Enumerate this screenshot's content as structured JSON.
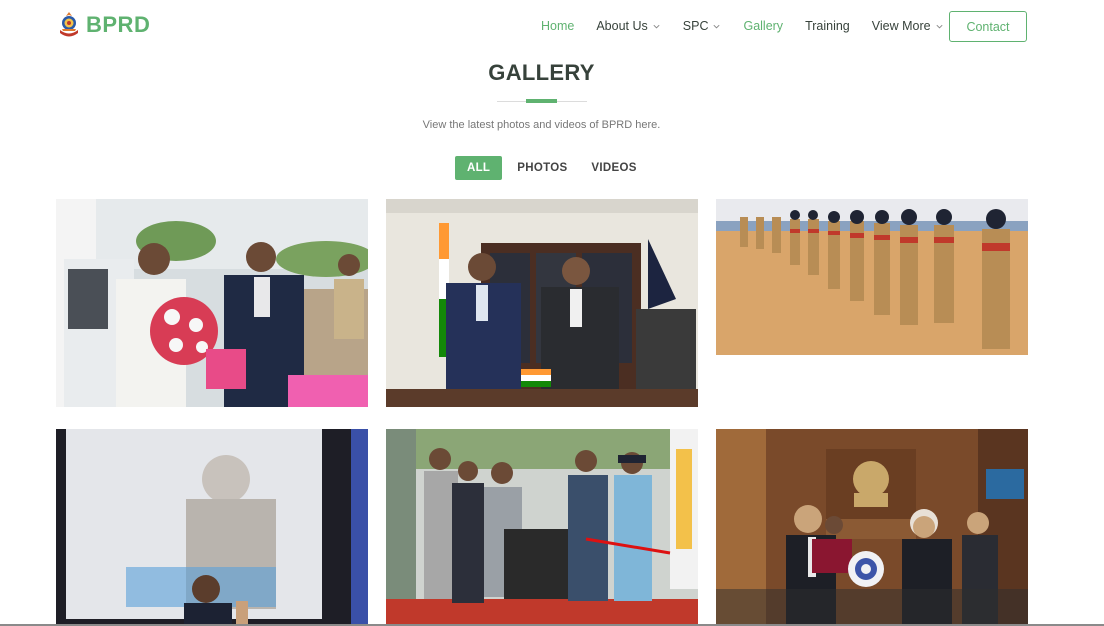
{
  "brand": {
    "name": "BPRD",
    "icon": "emblem-icon"
  },
  "nav": {
    "items": [
      {
        "label": "Home",
        "active": true,
        "dropdown": false
      },
      {
        "label": "About Us",
        "active": false,
        "dropdown": true
      },
      {
        "label": "SPC",
        "active": false,
        "dropdown": true
      },
      {
        "label": "Gallery",
        "active": true,
        "dropdown": false
      },
      {
        "label": "Training",
        "active": false,
        "dropdown": false
      },
      {
        "label": "View More",
        "active": false,
        "dropdown": true
      }
    ],
    "contact_label": "Contact"
  },
  "section": {
    "title": "GALLERY",
    "subtitle": "View the latest photos and videos of BPRD here."
  },
  "filters": [
    {
      "label": "ALL",
      "active": true
    },
    {
      "label": "PHOTOS",
      "active": false
    },
    {
      "label": "VIDEOS",
      "active": false
    }
  ],
  "colors": {
    "accent": "#5fb270",
    "heading": "#37423b"
  },
  "gallery": {
    "photos": [
      {
        "name": "photo-flower-welcome",
        "icon": "photo-icon"
      },
      {
        "name": "photo-handshake-office",
        "icon": "photo-icon"
      },
      {
        "name": "photo-parade-march",
        "icon": "photo-icon"
      },
      {
        "name": "photo-conference-speaker",
        "icon": "photo-icon"
      },
      {
        "name": "photo-ribbon-cutting",
        "icon": "photo-icon"
      },
      {
        "name": "photo-memento-presentation",
        "icon": "photo-icon"
      }
    ]
  }
}
